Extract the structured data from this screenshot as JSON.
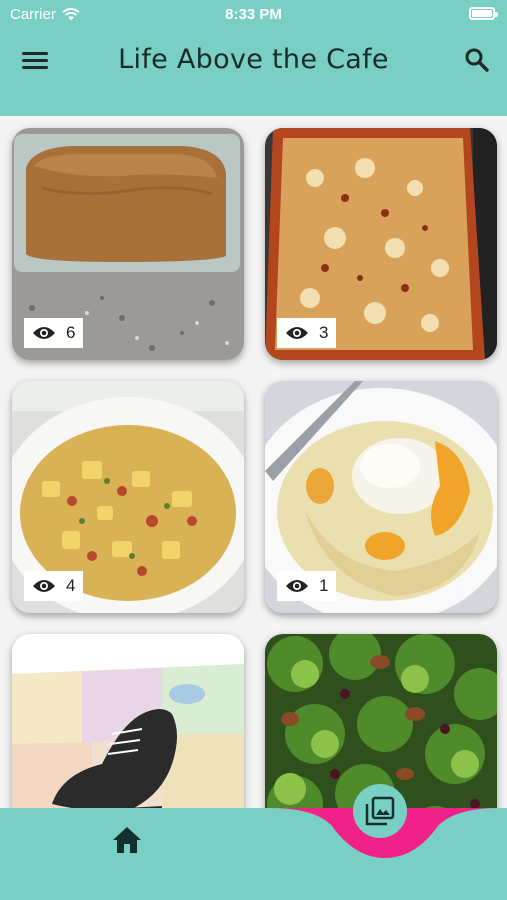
{
  "status_bar": {
    "carrier": "Carrier",
    "time": "8:33 PM"
  },
  "header": {
    "title": "Life Above the Cafe",
    "menu_icon": "hamburger-menu-icon",
    "search_icon": "search-icon"
  },
  "posts": [
    {
      "name": "banana-bread",
      "views": "6"
    },
    {
      "name": "baked-casserole",
      "views": "3"
    },
    {
      "name": "breakfast-hash",
      "views": "4"
    },
    {
      "name": "peach-cobbler",
      "views": "1"
    },
    {
      "name": "running-map",
      "views": ""
    },
    {
      "name": "broccoli-salad",
      "views": ""
    }
  ],
  "bottom_nav": {
    "home_icon": "home-icon",
    "gallery_icon": "gallery-icon"
  },
  "colors": {
    "accent": "#79cfc4",
    "highlight": "#f0228a",
    "text": "#1c2b2a"
  }
}
